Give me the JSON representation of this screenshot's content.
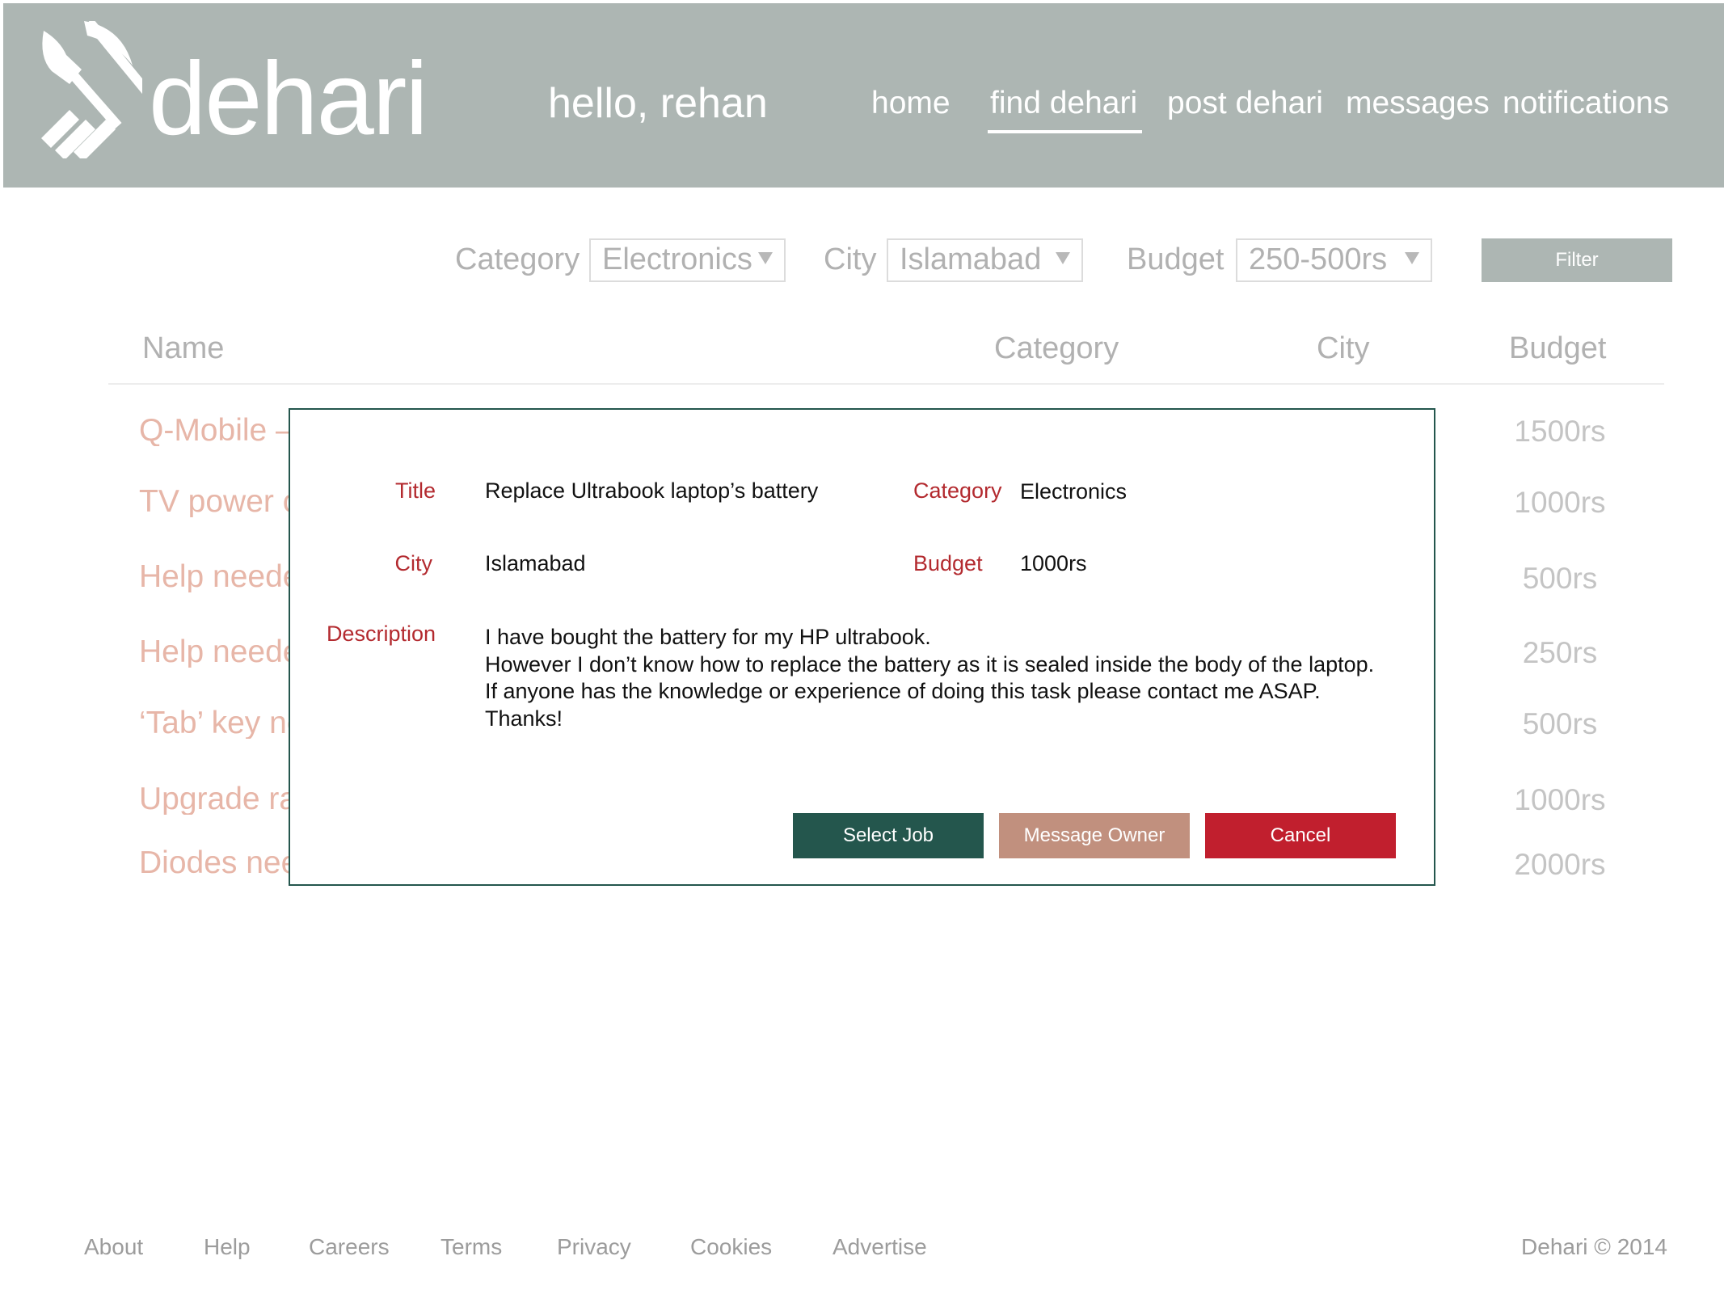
{
  "colors": {
    "header_bg": "#adb6b3",
    "modal_border": "#24564d",
    "label_red": "#b32a2f",
    "select_job": "#24564d",
    "message_owner": "#c1907e",
    "cancel": "#c11f2e",
    "job_title_faded": "#e7b6a8"
  },
  "header": {
    "logo_icon": "shovel-pickaxe-logo",
    "brand": "dehari",
    "greeting": "hello, rehan",
    "nav": [
      "home",
      "find dehari",
      "post dehari",
      "messages",
      "notifications"
    ],
    "active_nav": "find dehari"
  },
  "filters": {
    "category_label": "Category",
    "category_value": "Electronics",
    "city_label": "City",
    "city_value": "Islamabad",
    "budget_label": "Budget",
    "budget_value": "250-500rs",
    "filter_button": "Filter"
  },
  "table": {
    "headers": [
      "Name",
      "Category",
      "City",
      "Budget"
    ],
    "rows": [
      {
        "name": "Q-Mobile –",
        "budget": "1500rs"
      },
      {
        "name": "TV power c",
        "budget": "1000rs"
      },
      {
        "name": "Help neede",
        "budget": "500rs"
      },
      {
        "name": "Help neede",
        "budget": "250rs"
      },
      {
        "name": "‘Tab’ key no",
        "budget": "500rs"
      },
      {
        "name": "Upgrade ra",
        "budget": "1000rs"
      },
      {
        "name": "Diodes nee",
        "budget": "2000rs"
      }
    ]
  },
  "modal": {
    "title_label": "Title",
    "title_value": "Replace Ultrabook laptop’s battery",
    "category_label": "Category",
    "category_value": "Electronics",
    "city_label": "City",
    "city_value": "Islamabad",
    "budget_label": "Budget",
    "budget_value": "1000rs",
    "description_label": "Description",
    "description_lines": [
      "I have bought the battery for my HP ultrabook.",
      "However I don’t know how to replace the battery as it is sealed inside the body of the laptop.",
      "If anyone has the knowledge or experience of doing this task please contact me ASAP.",
      "Thanks!"
    ],
    "buttons": {
      "select_job": "Select Job",
      "message_owner": "Message Owner",
      "cancel": "Cancel"
    }
  },
  "footer": {
    "links": [
      "About",
      "Help",
      "Careers",
      "Terms",
      "Privacy",
      "Cookies",
      "Advertise"
    ],
    "copyright": "Dehari © 2014"
  }
}
